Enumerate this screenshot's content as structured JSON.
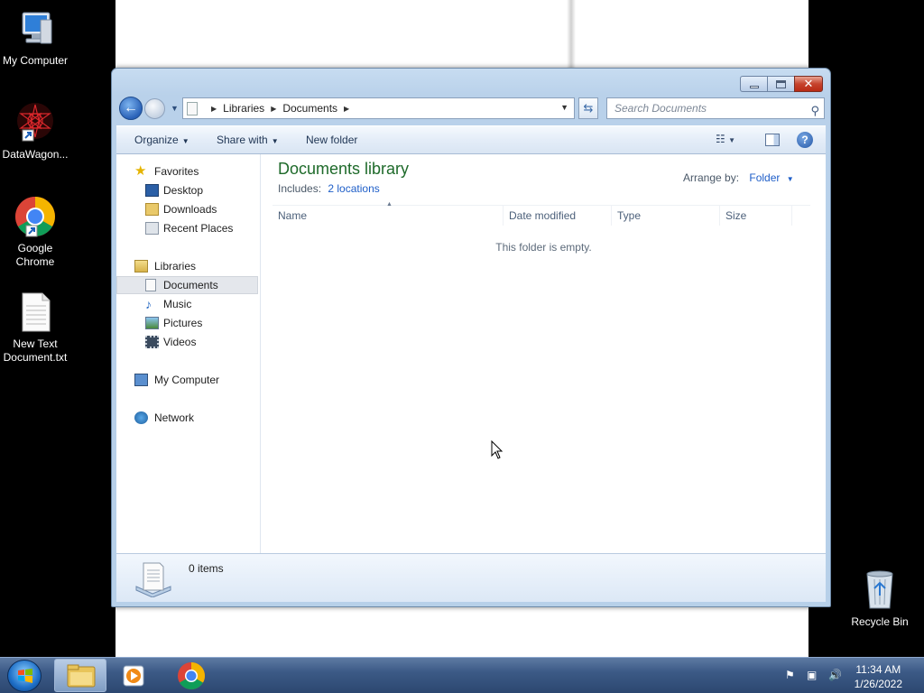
{
  "desktop": {
    "icons": [
      {
        "label": "My Computer"
      },
      {
        "label": "DataWagon..."
      },
      {
        "label": "Google Chrome"
      },
      {
        "label": "New Text Document.txt"
      }
    ],
    "recycle_bin": "Recycle Bin"
  },
  "window": {
    "address": {
      "crumbs": [
        "Libraries",
        "Documents"
      ]
    },
    "search_placeholder": "Search Documents",
    "toolbar": {
      "organize": "Organize",
      "share_with": "Share with",
      "new_folder": "New folder"
    },
    "nav": {
      "favorites": "Favorites",
      "desktop": "Desktop",
      "downloads": "Downloads",
      "recent_places": "Recent Places",
      "libraries": "Libraries",
      "documents": "Documents",
      "music": "Music",
      "pictures": "Pictures",
      "videos": "Videos",
      "my_computer": "My Computer",
      "network": "Network"
    },
    "content": {
      "title": "Documents library",
      "includes_label": "Includes:",
      "includes_link": "2 locations",
      "arrange_label": "Arrange by:",
      "arrange_value": "Folder",
      "columns": [
        "Name",
        "Date modified",
        "Type",
        "Size"
      ],
      "empty_message": "This folder is empty."
    },
    "details": {
      "item_count": "0 items"
    }
  },
  "taskbar": {
    "time": "11:34 AM",
    "date": "1/26/2022"
  },
  "colors": {
    "library_title": "#1e6a2a",
    "link": "#1e5ec8",
    "taskbar": "#3c5a86"
  }
}
